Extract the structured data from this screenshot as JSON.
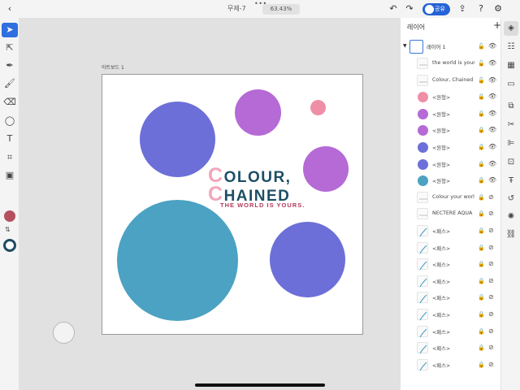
{
  "topbar": {
    "doc_title": "무제-7",
    "zoom": "63.43%",
    "share_label": "공유",
    "icons": [
      "back-icon",
      "undo-icon",
      "redo-icon",
      "share-icon",
      "export-icon",
      "help-icon",
      "settings-icon"
    ]
  },
  "tools": [
    "selection-tool-icon",
    "direct-selection-icon",
    "pen-icon",
    "paintbrush-icon",
    "eraser-icon",
    "shape-icon",
    "text-icon",
    "place-image-icon",
    "image-icon"
  ],
  "canvas": {
    "artboard_label": "아트보드 1",
    "logo": {
      "line1_cap": "C",
      "line1_rest": "OLOUR,",
      "line2_cap": "C",
      "line2_rest": "HAINED",
      "tagline": "THE WORLD IS YOURS."
    }
  },
  "colors": {
    "fill": "#b5515f",
    "stroke": "#1f4a63",
    "purple": "#6c6fd8",
    "violet": "#b56ad6",
    "pink": "#ef8fa7",
    "teal": "#4ca2c2"
  },
  "layers_panel": {
    "title": "레이어",
    "group_name": "레이어 1",
    "items": [
      {
        "name": "the world is yours.",
        "kind": "text",
        "color": "",
        "lock": "🔓",
        "eye": "👁"
      },
      {
        "name": "Colour, Chained",
        "kind": "text",
        "color": "",
        "lock": "🔓",
        "eye": "👁"
      },
      {
        "name": "<원형>",
        "kind": "circle",
        "color": "#ef8fa7",
        "lock": "🔒",
        "eye": "👁"
      },
      {
        "name": "<원형>",
        "kind": "circle",
        "color": "#b56ad6",
        "lock": "🔒",
        "eye": "👁"
      },
      {
        "name": "<원형>",
        "kind": "circle",
        "color": "#b56ad6",
        "lock": "🔒",
        "eye": "👁"
      },
      {
        "name": "<원형>",
        "kind": "circle",
        "color": "#6c6fd8",
        "lock": "🔒",
        "eye": "👁"
      },
      {
        "name": "<원형>",
        "kind": "circle",
        "color": "#6c6fd8",
        "lock": "🔒",
        "eye": "👁"
      },
      {
        "name": "<원형>",
        "kind": "circle",
        "color": "#4ca2c2",
        "lock": "🔒",
        "eye": "👁"
      },
      {
        "name": "Colour your world.",
        "kind": "text",
        "color": "",
        "lock": "🔒",
        "eye": "⊘"
      },
      {
        "name": "NECTERE AQUA",
        "kind": "text",
        "color": "",
        "lock": "🔒",
        "eye": "⊘"
      },
      {
        "name": "<패스>",
        "kind": "path",
        "color": "",
        "lock": "🔒",
        "eye": "⊘"
      },
      {
        "name": "<패스>",
        "kind": "path",
        "color": "",
        "lock": "🔒",
        "eye": "⊘"
      },
      {
        "name": "<패스>",
        "kind": "path",
        "color": "",
        "lock": "🔒",
        "eye": "⊘"
      },
      {
        "name": "<패스>",
        "kind": "path",
        "color": "",
        "lock": "🔒",
        "eye": "⊘"
      },
      {
        "name": "<패스>",
        "kind": "path",
        "color": "",
        "lock": "🔒",
        "eye": "⊘"
      },
      {
        "name": "<패스>",
        "kind": "path",
        "color": "",
        "lock": "🔒",
        "eye": "⊘"
      },
      {
        "name": "<패스>",
        "kind": "path",
        "color": "",
        "lock": "🔒",
        "eye": "⊘"
      },
      {
        "name": "<패스>",
        "kind": "path",
        "color": "",
        "lock": "🔒",
        "eye": "⊘"
      },
      {
        "name": "<패스>",
        "kind": "path",
        "color": "",
        "lock": "🔒",
        "eye": "⊘"
      }
    ]
  },
  "right_rail": [
    "layers-icon",
    "properties-icon",
    "libraries-icon",
    "comments-icon",
    "arrange-icon",
    "scissors-icon",
    "align-icon",
    "transform-icon",
    "type-icon",
    "curvature-icon",
    "gear-icon",
    "link-icon"
  ]
}
